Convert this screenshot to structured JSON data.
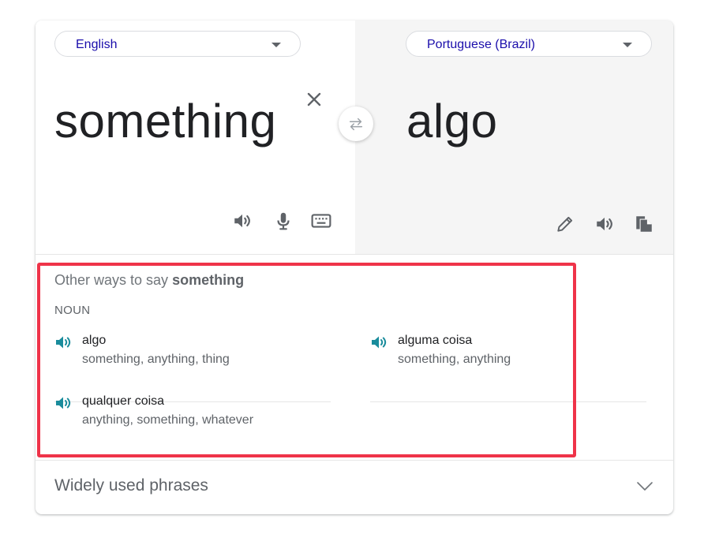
{
  "source": {
    "language": "English",
    "text": "something"
  },
  "target": {
    "language": "Portuguese (Brazil)",
    "text": "algo"
  },
  "icons": {
    "clear": "close-icon",
    "swap": "swap-icon",
    "source_listen": "speaker-icon",
    "source_voice": "microphone-icon",
    "source_keyboard": "keyboard-icon",
    "target_edit": "pencil-icon",
    "target_listen": "speaker-icon",
    "target_copy": "copy-icon",
    "phrases_expand": "chevron-down-icon"
  },
  "alternatives": {
    "heading_prefix": "Other ways to say ",
    "heading_word": "something",
    "part_of_speech": "NOUN",
    "entries": [
      {
        "word": "algo",
        "synonyms": "something, anything, thing"
      },
      {
        "word": "alguma coisa",
        "synonyms": "something, anything"
      },
      {
        "word": "qualquer coisa",
        "synonyms": "anything, something, whatever"
      }
    ]
  },
  "phrases": {
    "label": "Widely used phrases"
  },
  "colors": {
    "accent_link": "#1a0dab",
    "speaker_teal": "#1a8c9c",
    "highlight_red": "#ef3349",
    "target_pane_bg": "#f5f5f5"
  }
}
